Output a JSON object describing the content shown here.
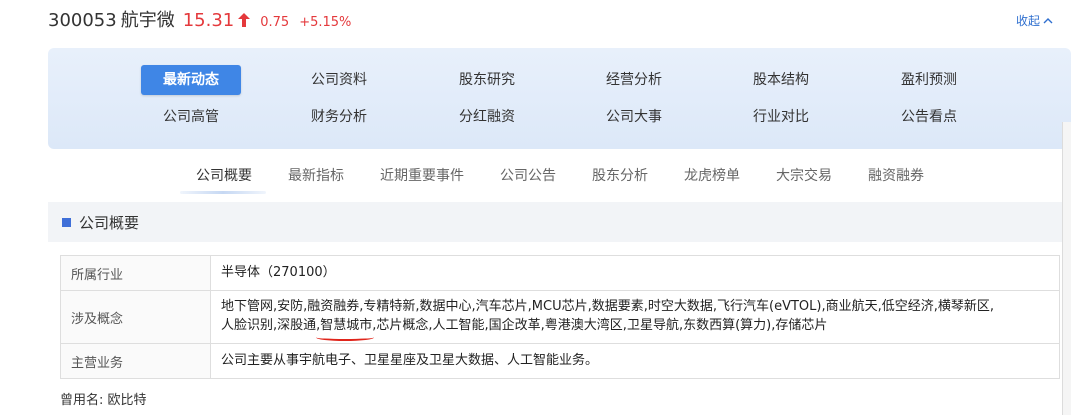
{
  "header": {
    "code": "300053",
    "name": "航宇微",
    "price": "15.31",
    "change": "0.75",
    "change_pct": "+5.15%",
    "price_color": "#e4393c",
    "collapse_label": "收起"
  },
  "nav": {
    "row1": [
      "最新动态",
      "公司资料",
      "股东研究",
      "经营分析",
      "股本结构",
      "盈利预测"
    ],
    "row2": [
      "公司高管",
      "财务分析",
      "分红融资",
      "公司大事",
      "行业对比",
      "公告看点"
    ],
    "active": "最新动态"
  },
  "subtabs": {
    "items": [
      "公司概要",
      "最新指标",
      "近期重要事件",
      "公司公告",
      "股东分析",
      "龙虎榜单",
      "大宗交易",
      "融资融券"
    ],
    "active": "公司概要"
  },
  "section": {
    "title": "公司概要"
  },
  "info": {
    "industry_label": "所属行业",
    "industry_value": "半导体（270100）",
    "concept_label": "涉及概念",
    "concept_line1": "地下管网,安防,融资融券,专精特新,数据中心,汽车芯片,MCU芯片,数据要素,时空大数据,飞行汽车(eVTOL),商业航天,低空经济,横琴新区,",
    "concept_line2_a": "人脸识别,深股通,",
    "concept_line2_mark": "智慧城市",
    "concept_line2_b": ",芯片概念,人工智能,国企改革,粤港澳大湾区,卫星导航,东数西算(算力),存储芯片",
    "business_label": "主营业务",
    "business_value": "公司主要从事宇航电子、卫星星座及卫星大数据、人工智能业务。"
  },
  "former_name": "曾用名: 欧比特"
}
